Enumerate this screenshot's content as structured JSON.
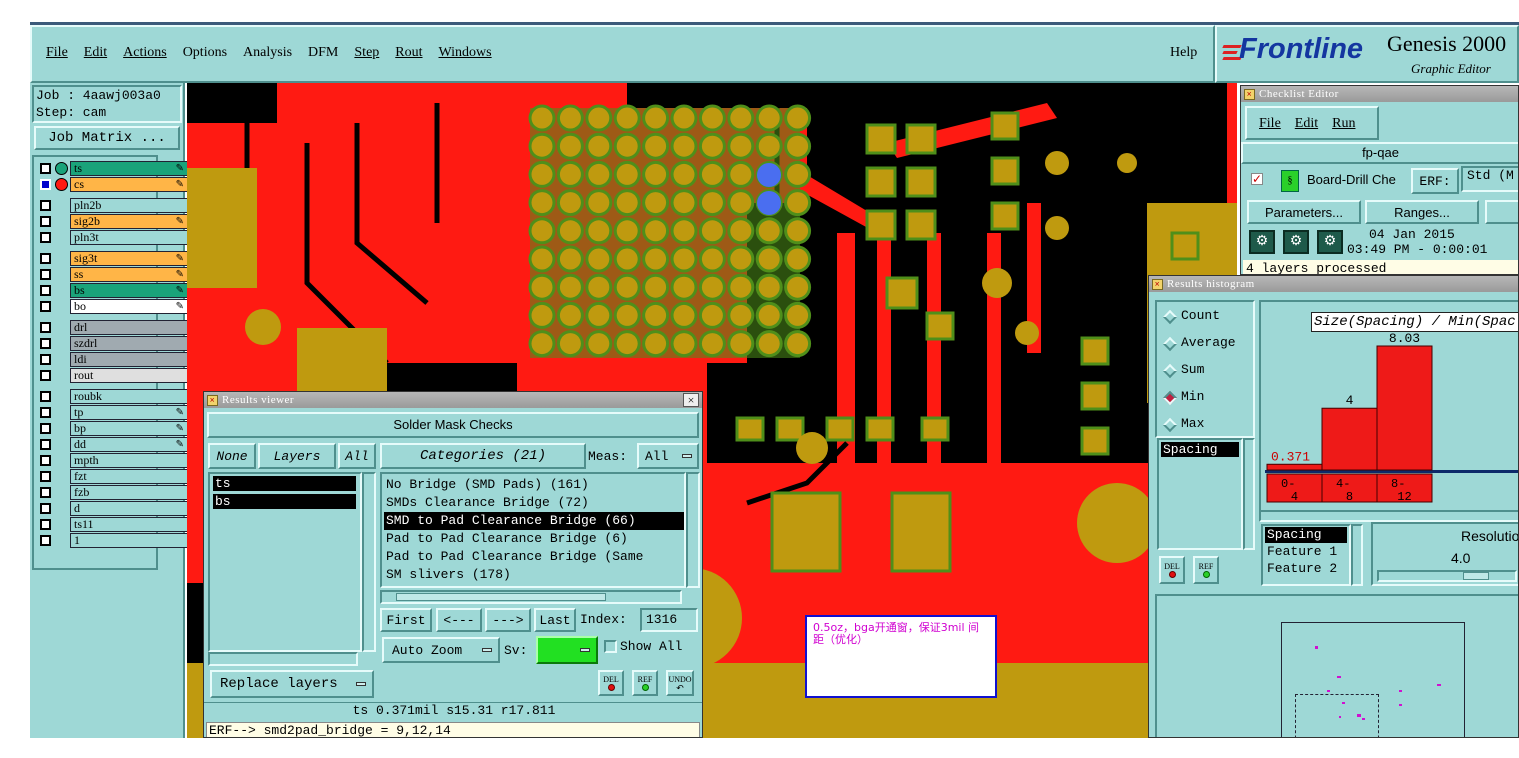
{
  "menu": {
    "items": [
      "File",
      "Edit",
      "Actions",
      "Options",
      "Analysis",
      "DFM",
      "Step",
      "Rout",
      "Windows"
    ],
    "help": "Help"
  },
  "brand": {
    "logo": "Frontline",
    "product": "Genesis 2000",
    "subtitle": "Graphic Editor"
  },
  "job": {
    "job_line": "Job : 4aawj003a0",
    "step_line": "Step: cam",
    "matrix_button": "Job Matrix ..."
  },
  "layers": [
    {
      "name": "ts",
      "color": "#1aa37a",
      "icon": "pencil-icon"
    },
    {
      "name": "cs",
      "color": "#ffb547",
      "icon": "pencil-icon"
    },
    {
      "name": "pln2b",
      "color": "#9ed8d6",
      "icon": ""
    },
    {
      "name": "sig2b",
      "color": "#ffb547",
      "icon": "pencil-icon"
    },
    {
      "name": "pln3t",
      "color": "#9ed8d6",
      "icon": ""
    },
    {
      "name": "sig3t",
      "color": "#ffb547",
      "icon": "pencil-icon"
    },
    {
      "name": "ss",
      "color": "#ffb547",
      "icon": "pencil-icon"
    },
    {
      "name": "bs",
      "color": "#1aa37a",
      "icon": "pencil-icon"
    },
    {
      "name": "bo",
      "color": "#ffffff",
      "icon": "pencil-icon"
    },
    {
      "name": "drl",
      "color": "#a0aab0",
      "icon": ""
    },
    {
      "name": "szdrl",
      "color": "#a0aab0",
      "icon": ""
    },
    {
      "name": "ldi",
      "color": "#a0aab0",
      "icon": ""
    },
    {
      "name": "rout",
      "color": "#dfdfdf",
      "icon": ""
    },
    {
      "name": "roubk",
      "color": "#9ed8d6",
      "icon": ""
    },
    {
      "name": "tp",
      "color": "#9ed8d6",
      "icon": "pencil-icon"
    },
    {
      "name": "bp",
      "color": "#9ed8d6",
      "icon": "pencil-icon"
    },
    {
      "name": "dd",
      "color": "#9ed8d6",
      "icon": "pencil-icon"
    },
    {
      "name": "mpth",
      "color": "#9ed8d6",
      "icon": ""
    },
    {
      "name": "fzt",
      "color": "#9ed8d6",
      "icon": ""
    },
    {
      "name": "fzb",
      "color": "#9ed8d6",
      "icon": ""
    },
    {
      "name": "d",
      "color": "#9ed8d6",
      "icon": ""
    },
    {
      "name": "ts11",
      "color": "#9ed8d6",
      "icon": ""
    },
    {
      "name": "1",
      "color": "#9ed8d6",
      "icon": ""
    }
  ],
  "results_viewer": {
    "title": "Results viewer",
    "header": "Solder Mask Checks",
    "none_btn": "None",
    "layers_btn": "Layers",
    "all_btn": "All",
    "categories_btn": "Categories (21)",
    "meas_label": "Meas:",
    "meas_value": "All",
    "layer_list": [
      "ts",
      "bs"
    ],
    "categories": [
      "No Bridge (SMD Pads) (161)",
      "SMDs Clearance Bridge (72)",
      "SMD to Pad Clearance Bridge (66)",
      "Pad to Pad Clearance Bridge (6)",
      "Pad to Pad Clearance Bridge (Same",
      "SM slivers (178)"
    ],
    "first": "First",
    "prev": "<---",
    "next": "--->",
    "last": "Last",
    "index_label": "Index:",
    "index_value": "1316",
    "auto_zoom": "Auto Zoom",
    "sv_label": "Sv:",
    "show_all": "Show All",
    "replace_layers": "Replace layers",
    "del": "DEL",
    "ref": "REF",
    "undo": "UNDO",
    "status": "ts 0.371mil  s15.31  r17.811",
    "erf_line": "ERF--> smd2pad_bridge = 9,12,14"
  },
  "annotation": {
    "text": "0.5oz，bga开通窗，保证3mil 间距（优化）"
  },
  "checklist": {
    "title": "Checklist Editor",
    "menu": [
      "File",
      "Edit",
      "Run"
    ],
    "name": "fp-qae",
    "row_label": "Board-Drill Che",
    "erf_label": "ERF:",
    "erf_value": "Std (M",
    "parameters": "Parameters...",
    "ranges": "Ranges...",
    "date": "04 Jan 2015",
    "time": "03:49 PM - 0:00:01",
    "status": "4 layers processed"
  },
  "histogram": {
    "title": "Results histogram",
    "modes": [
      "Count",
      "Average",
      "Sum",
      "Min",
      "Max"
    ],
    "selected_mode": "Min",
    "chart_title": "Size(Spacing) / Min(Spac",
    "list_top": [
      "Spacing"
    ],
    "list_bottom": [
      "Spacing",
      "Feature 1",
      "Feature 2"
    ],
    "resolution_label": "Resolutio",
    "resolution_value": "4.0",
    "del": "DEL",
    "ref": "REF",
    "bins": [
      {
        "label": "0-\n4",
        "value": 0.371,
        "value_label": "0.371"
      },
      {
        "label": "4-\n8",
        "value": 4,
        "value_label": "4"
      },
      {
        "label": "8-\n12",
        "value": 8.03,
        "value_label": "8.03"
      }
    ],
    "max": 8.03
  },
  "colors": {
    "teal": "#9ed8d6",
    "board_red": "#ff1a12",
    "pad_gold": "#bf9a0f",
    "pad_green": "#4f8f1a"
  }
}
